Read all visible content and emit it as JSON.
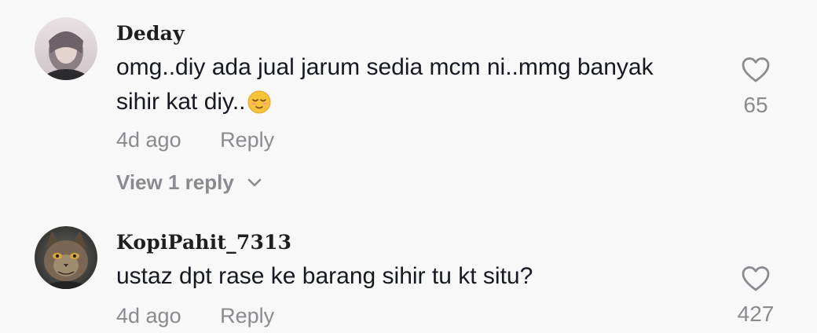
{
  "comments": [
    {
      "username": "Deday",
      "text_line1": "omg..diy ada jual jarum sedia mcm ni..mmg banyak",
      "text_line2": "sihir kat diy..",
      "emoji": "relieved-face-emoji",
      "time": "4d ago",
      "reply_label": "Reply",
      "likes": "65",
      "view_replies": "View 1 reply"
    },
    {
      "username": "KopiPahit_7313",
      "text_line1": "ustaz dpt rase ke barang sihir tu kt situ?",
      "time": "4d ago",
      "reply_label": "Reply",
      "likes": "427"
    }
  ],
  "colors": {
    "background": "#f8f8f8",
    "text": "#161823",
    "muted": "#8a8b91"
  },
  "icons": [
    "heart-outline-icon",
    "chevron-down-icon"
  ]
}
